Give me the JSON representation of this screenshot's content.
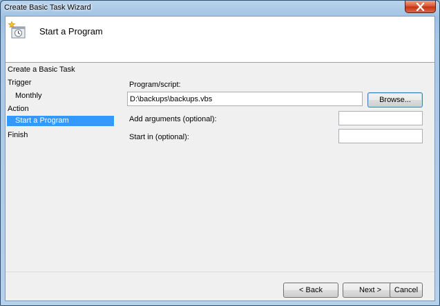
{
  "window": {
    "title": "Create Basic Task Wizard"
  },
  "header": {
    "title": "Start a Program"
  },
  "nav": {
    "items": [
      {
        "label": "Create a Basic Task"
      },
      {
        "label": "Trigger"
      },
      {
        "label": "Monthly"
      },
      {
        "label": "Action"
      },
      {
        "label": "Start a Program"
      },
      {
        "label": "Finish"
      }
    ]
  },
  "form": {
    "program_label": "Program/script:",
    "program_value": "D:\\backups\\backups.vbs",
    "browse_label": "Browse...",
    "arguments_label": "Add arguments (optional):",
    "arguments_value": "",
    "startin_label": "Start in (optional):",
    "startin_value": ""
  },
  "footer": {
    "back_label": "< Back",
    "next_label": "Next >",
    "cancel_label": "Cancel"
  },
  "colors": {
    "selection": "#3399ff",
    "close_button": "#c3320f"
  }
}
